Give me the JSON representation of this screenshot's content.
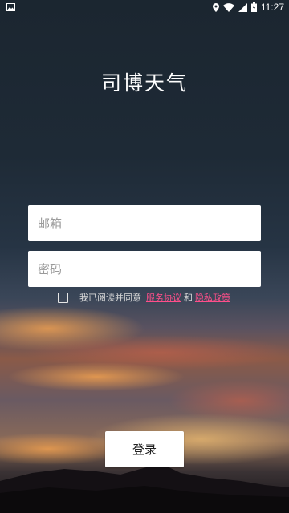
{
  "status_bar": {
    "time": "11:27",
    "icons": [
      "image-notification-icon",
      "location-icon",
      "wifi-icon",
      "signal-icon",
      "battery-icon"
    ]
  },
  "app": {
    "title": "司博天气"
  },
  "form": {
    "email_placeholder": "邮箱",
    "password_placeholder": "密码"
  },
  "agreement": {
    "prefix": "我已阅读并同意",
    "terms_link": "服务协议",
    "conjunction": "和",
    "privacy_link": "隐私政策",
    "checked": false
  },
  "login_button_label": "登录",
  "colors": {
    "link": "#ff4f8a",
    "field_background": "#ffffff"
  }
}
